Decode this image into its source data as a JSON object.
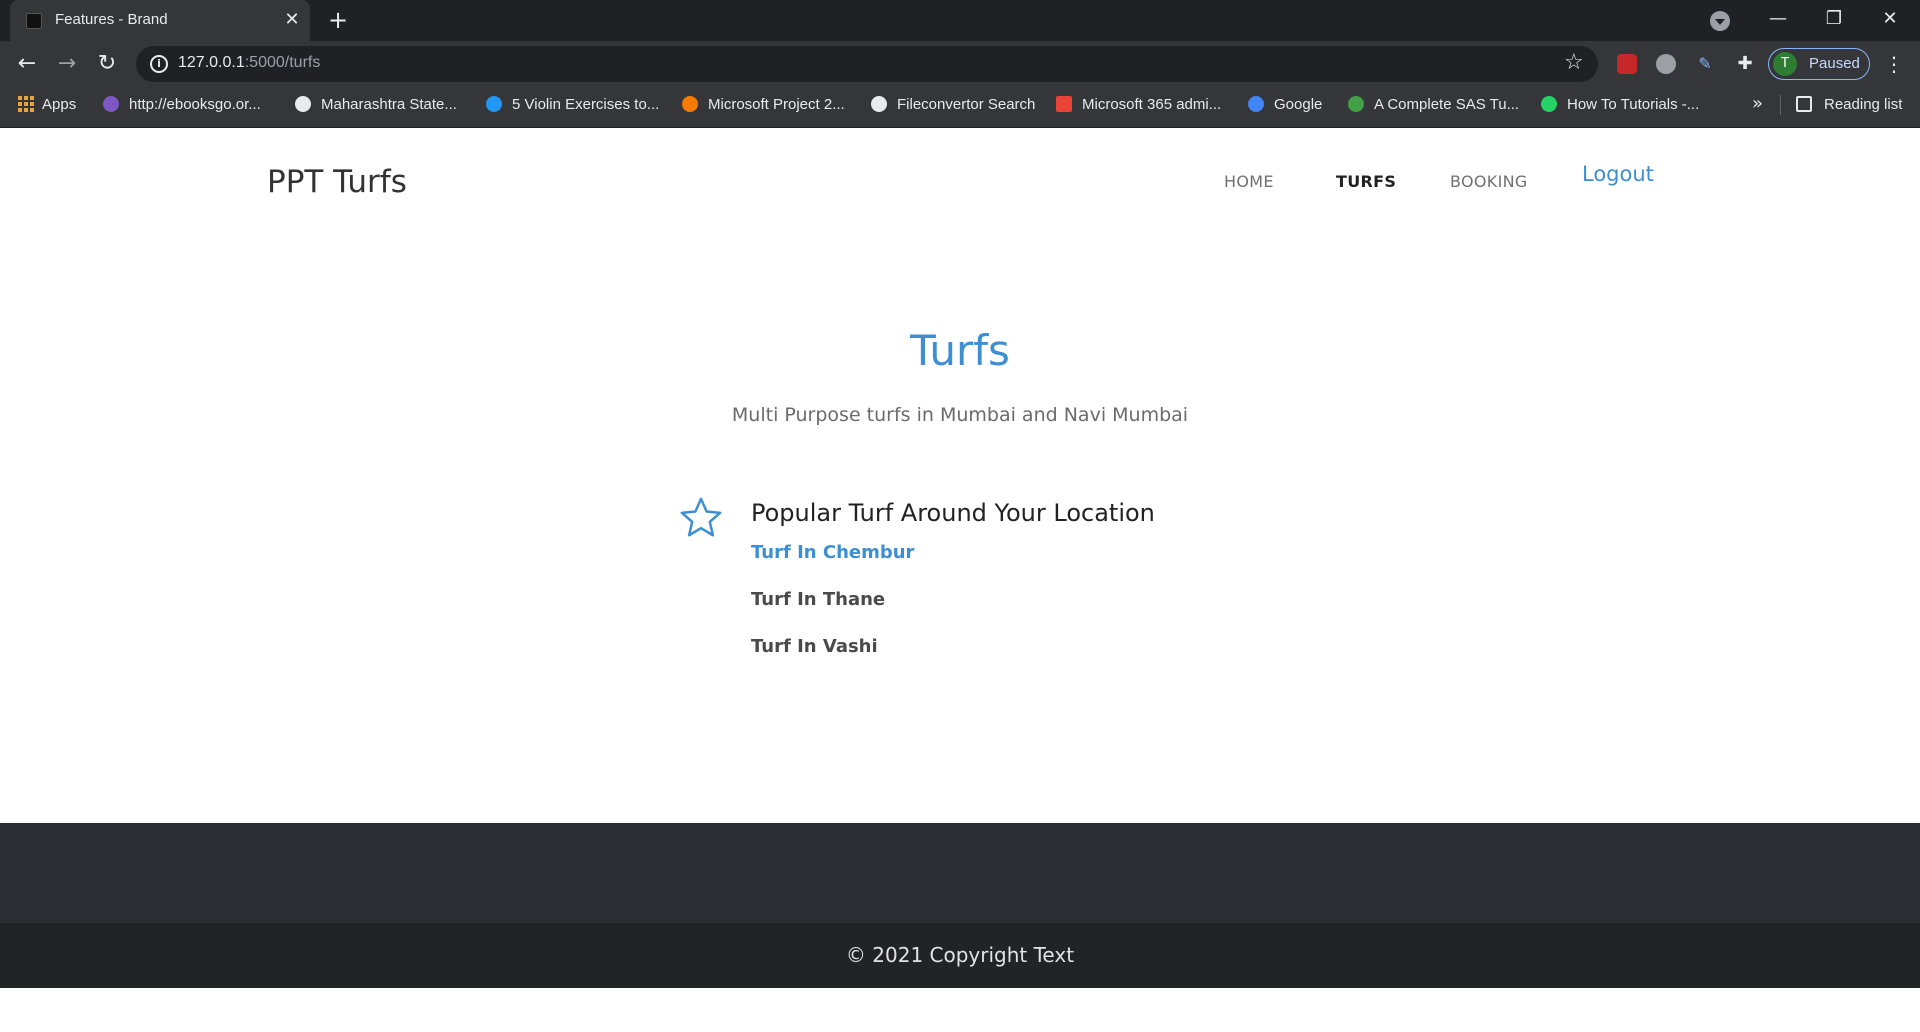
{
  "browser": {
    "tab_title": "Features - Brand",
    "url_host": "127.0.0.1",
    "url_path": ":5000/turfs",
    "profile_initial": "T",
    "profile_status": "Paused",
    "bookmarks": [
      {
        "label": "Apps",
        "icon": "apps-grid-icon"
      },
      {
        "label": "http://ebooksgo.or...",
        "icon": "ebooks-icon"
      },
      {
        "label": "Maharashtra State...",
        "icon": "maharashtra-icon"
      },
      {
        "label": "5 Violin Exercises to...",
        "icon": "wordpress-icon"
      },
      {
        "label": "Microsoft Project 2...",
        "icon": "project-icon"
      },
      {
        "label": "Fileconvertor Search",
        "icon": "github-icon"
      },
      {
        "label": "Microsoft 365 admi...",
        "icon": "gmail-icon"
      },
      {
        "label": "Google",
        "icon": "google-icon"
      },
      {
        "label": "A Complete SAS Tu...",
        "icon": "sas-icon"
      },
      {
        "label": "How To Tutorials -...",
        "icon": "tutorials-icon"
      }
    ],
    "reading_list": "Reading list"
  },
  "site": {
    "brand": "PPT Turfs",
    "nav": {
      "home": "HOME",
      "turfs": "TURFS",
      "booking": "BOOKING",
      "logout": "Logout"
    },
    "title": "Turfs",
    "subtitle": "Multi Purpose turfs in Mumbai and Navi Mumbai",
    "feature": {
      "icon": "star-icon",
      "heading": "Popular Turf Around Your Location",
      "items": [
        "Turf In Chembur",
        "Turf In Thane",
        "Turf In Vashi"
      ]
    },
    "copyright": "© 2021 Copyright Text"
  },
  "colors": {
    "accent": "#3d8fd1",
    "footer_top": "#2a2d31",
    "footer_bottom": "#212427"
  }
}
